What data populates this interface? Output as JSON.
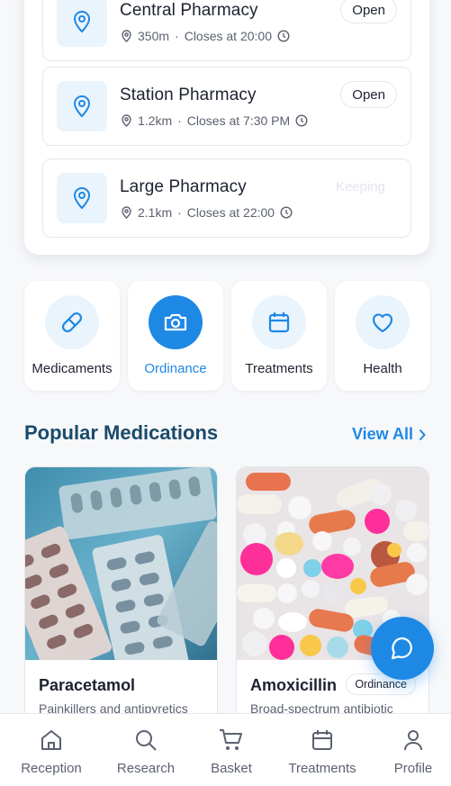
{
  "pharmacies": [
    {
      "name": "Central Pharmacy",
      "distance": "350m",
      "closing": "Closes at 20:00",
      "status": "Open"
    },
    {
      "name": "Station Pharmacy",
      "distance": "1.2km",
      "closing": "Closes at 7:30 PM",
      "status": "Open"
    },
    {
      "name": "Large Pharmacy",
      "distance": "2.1km",
      "closing": "Closes at 22:00",
      "status": "Keeping"
    }
  ],
  "separator": "·",
  "categories": [
    {
      "label": "Medicaments",
      "icon": "pill-icon",
      "active": false
    },
    {
      "label": "Ordinance",
      "icon": "camera-icon",
      "active": true
    },
    {
      "label": "Treatments",
      "icon": "calendar-icon",
      "active": false
    },
    {
      "label": "Health",
      "icon": "heart-icon",
      "active": false
    }
  ],
  "popular": {
    "title": "Popular Medications",
    "view_all": "View All"
  },
  "medications": [
    {
      "name": "Paracetamol",
      "description": "Painkillers and antipyretics",
      "badge": ""
    },
    {
      "name": "Amoxicillin",
      "description": "Broad-spectrum antibiotic",
      "badge": "Ordinance"
    }
  ],
  "nav": [
    {
      "label": "Reception",
      "icon": "home-icon"
    },
    {
      "label": "Research",
      "icon": "search-icon"
    },
    {
      "label": "Basket",
      "icon": "cart-icon"
    },
    {
      "label": "Treatments",
      "icon": "calendar-icon"
    },
    {
      "label": "Profile",
      "icon": "user-icon"
    }
  ],
  "colors": {
    "accent": "#1e88e5",
    "accent_light": "#e9f4fd",
    "heading": "#1a4a6b"
  }
}
